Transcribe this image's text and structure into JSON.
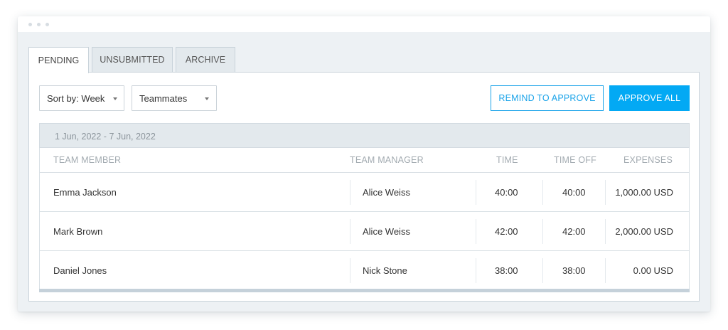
{
  "tabs": [
    {
      "label": "PENDING",
      "active": true
    },
    {
      "label": "UNSUBMITTED",
      "active": false
    },
    {
      "label": "ARCHIVE",
      "active": false
    }
  ],
  "filters": {
    "sort_label": "Sort by: Week",
    "teammates_label": "Teammates"
  },
  "actions": {
    "remind_label": "REMIND TO APPROVE",
    "approve_all_label": "APPROVE ALL"
  },
  "table": {
    "date_range": "1 Jun, 2022 - 7 Jun, 2022",
    "columns": [
      "TEAM MEMBER",
      "TEAM MANAGER",
      "TIME",
      "TIME OFF",
      "EXPENSES"
    ],
    "rows": [
      {
        "member": "Emma Jackson",
        "manager": "Alice Weiss",
        "time": "40:00",
        "time_off": "40:00",
        "expenses": "1,000.00 USD"
      },
      {
        "member": "Mark Brown",
        "manager": "Alice Weiss",
        "time": "42:00",
        "time_off": "42:00",
        "expenses": "2,000.00 USD"
      },
      {
        "member": "Daniel Jones",
        "manager": "Nick Stone",
        "time": "38:00",
        "time_off": "38:00",
        "expenses": "0.00 USD"
      }
    ]
  },
  "colors": {
    "accent": "#03a9f4",
    "background": "#edf1f4",
    "header_bar": "#e3e9ed"
  }
}
